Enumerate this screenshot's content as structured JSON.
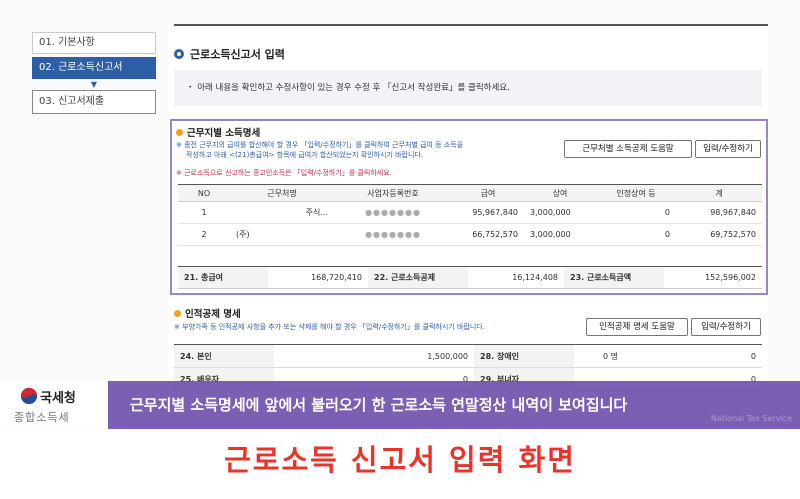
{
  "steps": [
    {
      "label": "01. 기본사항"
    },
    {
      "label": "02. 근로소득신고서"
    },
    {
      "label": "03. 신고서제출"
    }
  ],
  "main": {
    "section_title": "근로소득신고서 입력",
    "notice": "・ 아래 내용을 확인하고 수정사항이 있는 경우 수정 후 「신고서 작성완료」를 클릭하세요."
  },
  "wage_section": {
    "title": "근무지별 소득명세",
    "desc_line1": "※ 종전 근무지의 급여를 합산해야 할 경우 「입력/수정하기」를 클릭하여 근무처별 급여 등 소득을",
    "desc_line2": "작성하고 아래 <(21)총급여> 항목에 급여가 합산되었는지 확인하시기 바랍니다.",
    "desc_red": "※ 근로소득으로 신고하는 종교인소득은 「입력/수정하기」를 클릭하세요.",
    "help_button": "근무처별 소득공제 도움말",
    "edit_button": "입력/수정하기",
    "columns": [
      "NO",
      "근무처명",
      "사업자등록번호",
      "급여",
      "상여",
      "인정상여 등",
      "계"
    ],
    "rows": [
      {
        "no": "1",
        "name": "주식...",
        "bizno": "●●●●●●●",
        "salary": "95,967,840",
        "bonus": "3,000,000",
        "recognized": "0",
        "total": "98,967,840"
      },
      {
        "no": "2",
        "name": "(주)",
        "bizno": "●●●●●●●",
        "salary": "66,752,570",
        "bonus": "3,000,000",
        "recognized": "0",
        "total": "69,752,570"
      }
    ],
    "summary": {
      "gross_label": "21. 총급여",
      "gross_value": "168,720,410",
      "deduction_label": "22. 근로소득공제",
      "deduction_value": "16,124,408",
      "income_label": "23. 근로소득금액",
      "income_value": "152,596,002"
    }
  },
  "personal_section": {
    "title": "인적공제 명세",
    "desc": "※ 부양가족 등 인적공제 사항을 추가 또는 삭제를 해야 할 경우 「입력/수정하기」를 클릭하시기 바랍니다.",
    "help_button": "인적공제 명세 도움말",
    "edit_button": "입력/수정하기",
    "rows": [
      {
        "label1": "24. 본인",
        "value1": "1,500,000",
        "label2": "28. 장애인",
        "count2": "0 명",
        "value2": "0"
      },
      {
        "label1": "25. 배우자",
        "value1": "0",
        "label2": "29. 부녀자",
        "count2": "",
        "value2": "0"
      }
    ]
  },
  "overlay": {
    "logo_name": "국세청",
    "logo_sub": "종합소득세",
    "caption": "근무지별 소득명세에 앞에서 불러오기 한 근로소득 연말정산 내역이 보여집니다",
    "watermark": "National Tax Service",
    "bottom_title": "근로소득 신고서 입력 화면"
  },
  "colors": {
    "accent_blue": "#2e5fa6",
    "purple_border": "#9c86c6",
    "caption_purple": "#6c4eab",
    "title_red": "#e8342a"
  }
}
